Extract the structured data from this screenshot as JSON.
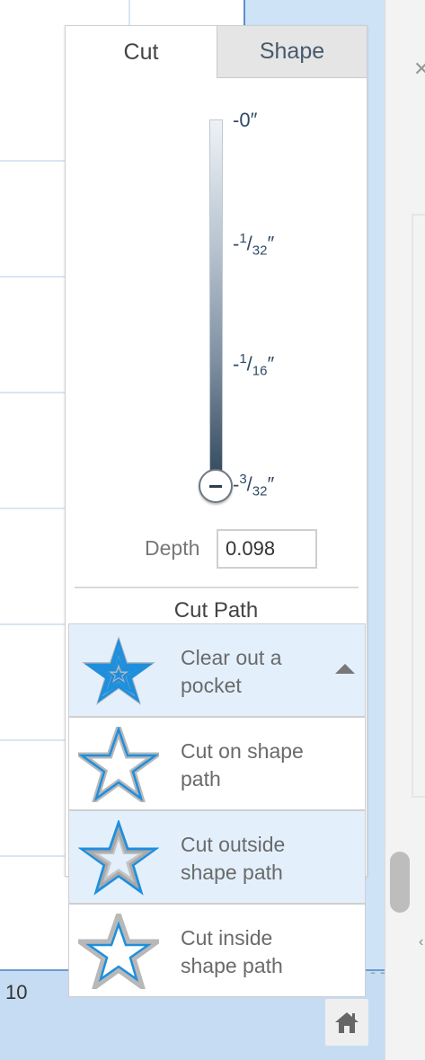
{
  "tabs": [
    {
      "label": "Cut",
      "active": true
    },
    {
      "label": "Shape",
      "active": false
    }
  ],
  "depth_scale": {
    "ticks": [
      {
        "sign": "-",
        "whole": "0",
        "num": "",
        "den": "",
        "unit": "″"
      },
      {
        "sign": "-",
        "whole": "",
        "num": "1",
        "den": "32",
        "unit": "″"
      },
      {
        "sign": "-",
        "whole": "",
        "num": "1",
        "den": "16",
        "unit": "″"
      },
      {
        "sign": "-",
        "whole": "",
        "num": "3",
        "den": "32",
        "unit": "″"
      }
    ]
  },
  "depth": {
    "label": "Depth",
    "value": "0.098"
  },
  "cut_path": {
    "title": "Cut Path",
    "options": [
      {
        "label_line1": "Clear out a",
        "label_line2": "pocket",
        "icon": "pocket-star-icon",
        "selected": true,
        "expanded_caret": true
      },
      {
        "label_line1": "Cut on shape",
        "label_line2": "path",
        "icon": "on-path-star-icon",
        "selected": false
      },
      {
        "label_line1": "Cut outside",
        "label_line2": "shape path",
        "icon": "outside-path-star-icon",
        "selected": false,
        "hovered": true
      },
      {
        "label_line1": "Cut inside",
        "label_line2": "shape path",
        "icon": "inside-path-star-icon",
        "selected": false
      }
    ]
  },
  "ruler": {
    "bottom_label": "10"
  },
  "colors": {
    "accent": "#1f8fdd",
    "selected_bg": "#e3f0fc",
    "star_gray": "#b0b0b0"
  },
  "icons": {
    "home": "home-icon",
    "caret": "caret-up-icon",
    "close": "close-icon"
  }
}
